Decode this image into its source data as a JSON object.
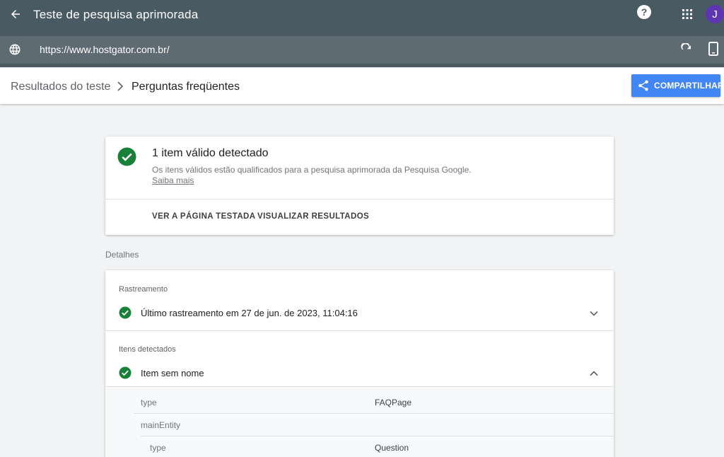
{
  "app": {
    "title": "Teste de pesquisa aprimorada",
    "avatar_initial": "J",
    "help_glyph": "?",
    "url": "https://www.hostgator.com.br/"
  },
  "breadcrumb": {
    "parent": "Resultados do teste",
    "current": "Perguntas freqüentes"
  },
  "share_label": "COMPARTILHAR",
  "summary": {
    "heading": "1 item válido detectado",
    "description": "Os itens válidos estão qualificados para a pesquisa aprimorada da Pesquisa Google.",
    "learn_more": "Saiba mais",
    "actions": [
      "VER A PÁGINA TESTADA",
      "VISUALIZAR RESULTADOS"
    ]
  },
  "details": {
    "label": "Detalhes",
    "crawl": {
      "label": "Rastreamento",
      "text": "Último rastreamento em 27 de jun. de 2023, 11:04:16"
    },
    "detected": {
      "label": "Itens detectados",
      "item": "Item sem nome",
      "properties": [
        {
          "key": "type",
          "value": "FAQPage"
        },
        {
          "key": "mainEntity",
          "value": ""
        },
        {
          "key": "type",
          "value": "Question"
        }
      ]
    }
  },
  "colors": {
    "topbar": "#4a5a63",
    "urlbar": "#5f6b73",
    "accent": "#4285f4",
    "success": "#188038",
    "avatar": "#5e35b1"
  }
}
